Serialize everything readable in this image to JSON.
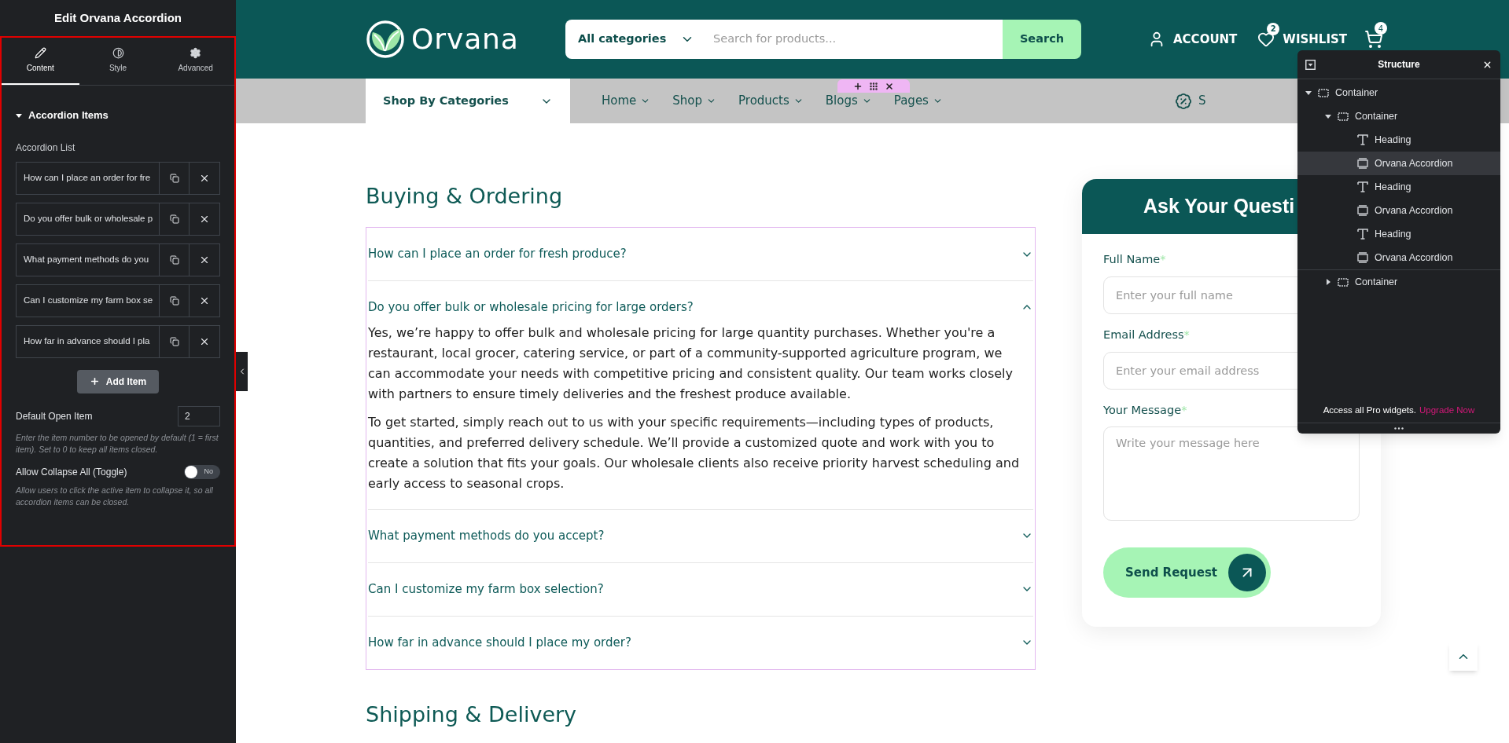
{
  "editor": {
    "title": "Edit Orvana Accordion",
    "tabs": [
      {
        "label": "Content",
        "selected": true
      },
      {
        "label": "Style",
        "selected": false
      },
      {
        "label": "Advanced",
        "selected": false
      }
    ],
    "section": {
      "title": "Accordion Items",
      "expanded": true
    },
    "list_label": "Accordion List",
    "list_items": [
      "How can I place an order for fre",
      "Do you offer bulk or wholesale p",
      "What payment methods do you",
      "Can I customize my farm box se",
      "How far in advance should I pla"
    ],
    "add_button": "Add Item",
    "default_open": {
      "label": "Default Open Item",
      "value": "2",
      "help": "Enter the item number to be opened by default (1 = first item). Set to 0 to keep all items closed."
    },
    "collapse_toggle": {
      "label": "Allow Collapse All (Toggle)",
      "on": false,
      "state_text": "No",
      "help": "Allow users to click the active item to collapse it, so all accordion items can be closed."
    }
  },
  "header": {
    "logo": "Orvana",
    "category_select": "All categories",
    "search_placeholder": "Search for products...",
    "search_button": "Search",
    "account": "ACCOUNT",
    "wishlist": {
      "label": "WISHLIST",
      "count": "2"
    },
    "cart_count": "4"
  },
  "nav": {
    "categories_button": "Shop By Categories",
    "items": [
      {
        "label": "Home"
      },
      {
        "label": "Shop"
      },
      {
        "label": "Products"
      },
      {
        "label": "Blogs"
      },
      {
        "label": "Pages"
      }
    ],
    "offer": "S"
  },
  "section_heading": "Buying & Ordering",
  "accordion": [
    {
      "question": "How can I place an order for fresh produce?",
      "expanded": false
    },
    {
      "question": "Do you offer bulk or wholesale pricing for large orders?",
      "expanded": true,
      "answer": [
        "Yes, we’re happy to offer bulk and wholesale pricing for large quantity purchases. Whether you're a restaurant, local grocer, catering service, or part of a community-supported agriculture program, we can accommodate your needs with competitive pricing and consistent quality. Our team works closely with partners to ensure timely deliveries and the freshest produce available.",
        "To get started, simply reach out to us with your specific requirements—including types of products, quantities, and preferred delivery schedule. We’ll provide a customized quote and work with you to create a solution that fits your goals. Our wholesale clients also receive priority harvest scheduling and early access to seasonal crops."
      ]
    },
    {
      "question": "What payment methods do you accept?",
      "expanded": false
    },
    {
      "question": "Can I customize my farm box selection?",
      "expanded": false
    },
    {
      "question": "How far in advance should I place my order?",
      "expanded": false
    }
  ],
  "next_heading": "Shipping & Delivery",
  "form": {
    "title": "Ask Your Questi",
    "fields": [
      {
        "kind": "input",
        "label": "Full Name",
        "required_mark": "*",
        "placeholder": "Enter your full name"
      },
      {
        "kind": "input",
        "label": "Email Address",
        "required_mark": "*",
        "placeholder": "Enter your email address"
      },
      {
        "kind": "textarea",
        "label": "Your Message",
        "required_mark": "*",
        "placeholder": "Write your message here"
      }
    ],
    "submit": "Send Request"
  },
  "structure": {
    "title": "Structure",
    "tree": [
      {
        "label": "Container",
        "kind": "container",
        "expanded": true,
        "selected": false,
        "children": [
          {
            "label": "Container",
            "kind": "container",
            "expanded": true,
            "selected": false,
            "children": [
              {
                "label": "Heading",
                "kind": "heading",
                "selected": false
              },
              {
                "label": "Orvana Accordion",
                "kind": "accordion",
                "selected": true
              },
              {
                "label": "Heading",
                "kind": "heading",
                "selected": false
              },
              {
                "label": "Orvana Accordion",
                "kind": "accordion",
                "selected": false
              },
              {
                "label": "Heading",
                "kind": "heading",
                "selected": false
              },
              {
                "label": "Orvana Accordion",
                "kind": "accordion",
                "selected": false
              }
            ]
          },
          {
            "label": "Container",
            "kind": "container",
            "expanded": false,
            "selected": false
          }
        ]
      }
    ],
    "promo": {
      "text": "Access all Pro widgets.",
      "link": "Upgrade Now"
    }
  }
}
